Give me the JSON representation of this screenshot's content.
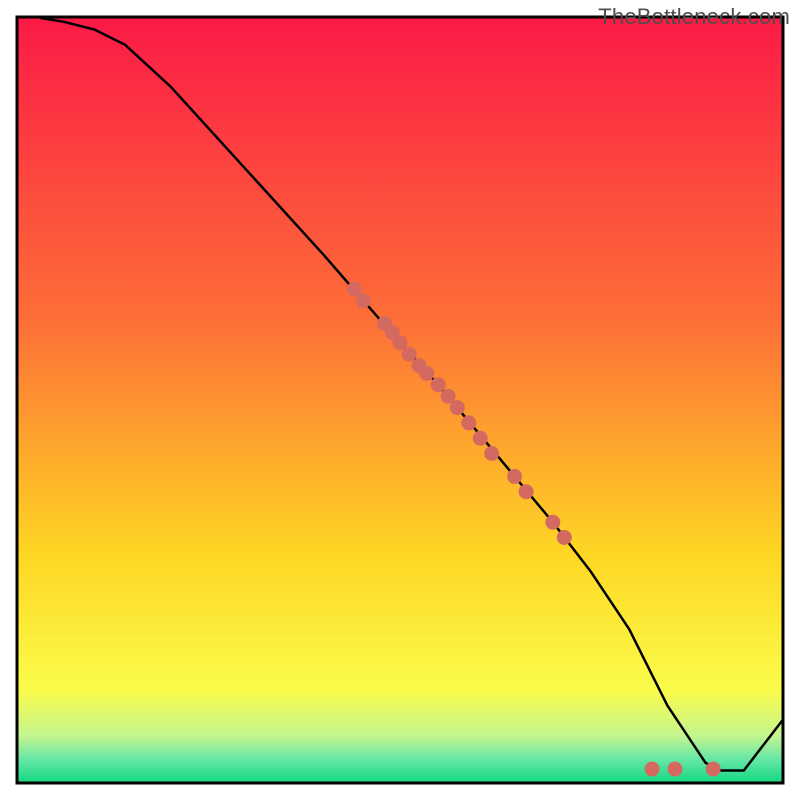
{
  "watermark": "TheBottleneck.com",
  "chart_data": {
    "type": "line",
    "title": "",
    "xlabel": "",
    "ylabel": "",
    "xlim": [
      0,
      100
    ],
    "ylim": [
      0,
      100
    ],
    "series": [
      {
        "name": "curve",
        "x": [
          3,
          6,
          10,
          14,
          20,
          30,
          40,
          50,
          55,
          60,
          65,
          70,
          75,
          80,
          82,
          85,
          90,
          92,
          95,
          100
        ],
        "y": [
          100,
          99.5,
          98.5,
          96.5,
          91,
          80,
          69,
          57.5,
          52,
          46,
          40,
          34,
          27.5,
          20,
          16,
          10,
          2.5,
          1.5,
          1.5,
          8
        ]
      }
    ],
    "scatter": {
      "name": "markers",
      "color": "#d46a5f",
      "points": [
        {
          "x": 44.0,
          "y": 64.5
        },
        {
          "x": 45.2,
          "y": 63.0
        },
        {
          "x": 48.0,
          "y": 60.0
        },
        {
          "x": 49.0,
          "y": 58.8
        },
        {
          "x": 50.0,
          "y": 57.5
        },
        {
          "x": 51.2,
          "y": 56.0
        },
        {
          "x": 52.5,
          "y": 54.5
        },
        {
          "x": 53.5,
          "y": 53.5
        },
        {
          "x": 55.0,
          "y": 52.0
        },
        {
          "x": 56.3,
          "y": 50.5
        },
        {
          "x": 57.5,
          "y": 49.0
        },
        {
          "x": 59.0,
          "y": 47.0
        },
        {
          "x": 60.5,
          "y": 45.0
        },
        {
          "x": 62.0,
          "y": 43.0
        },
        {
          "x": 65.0,
          "y": 40.0
        },
        {
          "x": 66.5,
          "y": 38.0
        },
        {
          "x": 70.0,
          "y": 34.0
        },
        {
          "x": 71.5,
          "y": 32.0
        },
        {
          "x": 83.0,
          "y": 1.7
        },
        {
          "x": 86.0,
          "y": 1.7
        },
        {
          "x": 91.0,
          "y": 1.7
        }
      ]
    },
    "gradient_bands": [
      {
        "y0": 100,
        "y1": 60,
        "c0": "#fb1a46",
        "c1": "#fd7037"
      },
      {
        "y0": 60,
        "y1": 30,
        "c0": "#fd7037",
        "c1": "#fed624"
      },
      {
        "y0": 30,
        "y1": 12,
        "c0": "#fed624",
        "c1": "#fbfc4a"
      },
      {
        "y0": 12,
        "y1": 6,
        "c0": "#fbfc4a",
        "c1": "#c3f58f"
      },
      {
        "y0": 6,
        "y1": 3,
        "c0": "#c3f58f",
        "c1": "#66e7a6"
      },
      {
        "y0": 3,
        "y1": 0,
        "c0": "#66e7a6",
        "c1": "#16d983"
      }
    ],
    "frame_inset": {
      "left": 18,
      "right": 18,
      "top": 18,
      "bottom": 18
    }
  }
}
